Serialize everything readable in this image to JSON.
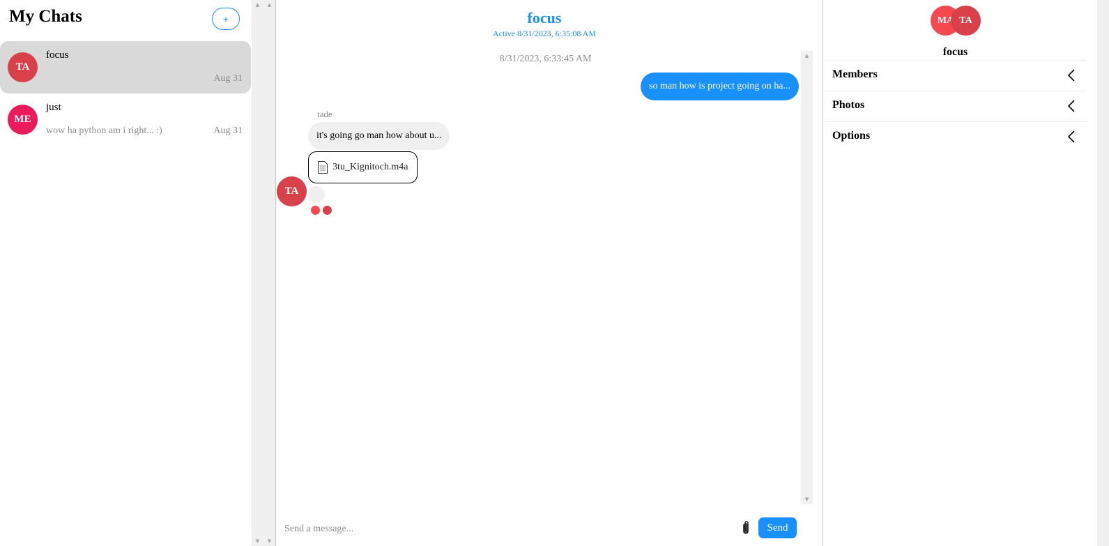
{
  "sidebar": {
    "title": "My Chats",
    "new_chat_label": "+",
    "chats": [
      {
        "initials": "TA",
        "name": "focus",
        "preview": "",
        "date": "Aug 31",
        "avatar_color": "#d9414a",
        "active": true
      },
      {
        "initials": "ME",
        "name": "just",
        "preview": "wow ha python am i right... :)",
        "date": "Aug 31",
        "avatar_color": "#eb1a5c",
        "active": false
      }
    ]
  },
  "chat": {
    "title": "focus",
    "status": "Active 8/31/2023, 6:35:08 AM",
    "timestamp": "8/31/2023, 6:33:45 AM",
    "outgoing_message": "so man how is project going on ha...",
    "sender_name": "tade",
    "incoming_message": "it's going go man how about u...",
    "attachment_name": "3tu_Kignitoch.m4a",
    "sender_initials": "TA",
    "read_receipts": [
      {
        "color": "#f5484f"
      },
      {
        "color": "#d9414a"
      }
    ],
    "composer": {
      "placeholder": "Send a message...",
      "send_label": "Send"
    }
  },
  "details": {
    "avatars": [
      {
        "initials": "MA",
        "color": "#f5484f"
      },
      {
        "initials": "TA",
        "color": "#d9414a"
      }
    ],
    "name": "focus",
    "sections": [
      {
        "label": "Members"
      },
      {
        "label": "Photos"
      },
      {
        "label": "Options"
      }
    ]
  },
  "colors": {
    "accent": "#1890ff",
    "active_chat_bg": "#d9d9d9",
    "incoming_bubble": "#f0f0f0"
  }
}
